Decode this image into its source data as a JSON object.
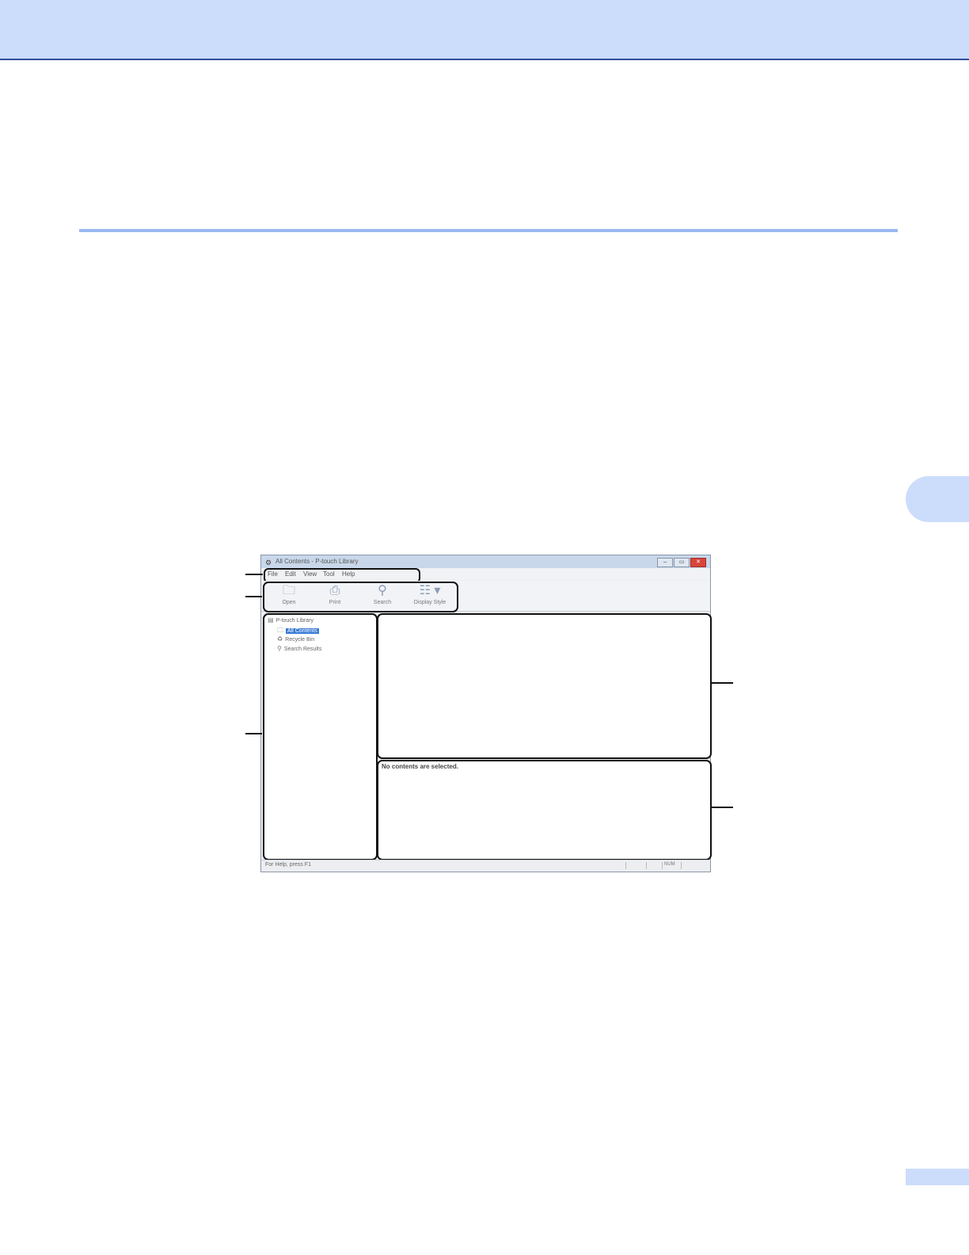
{
  "window": {
    "title": "All Contents - P-touch Library",
    "buttons": {
      "minimize": "–",
      "maximize": "▭",
      "close": "✕"
    }
  },
  "menu": [
    "File",
    "Edit",
    "View",
    "Tool",
    "Help"
  ],
  "toolbar": [
    {
      "label": "Open",
      "icon": "open-folder-icon"
    },
    {
      "label": "Print",
      "icon": "print-icon"
    },
    {
      "label": "Search",
      "icon": "search-icon"
    },
    {
      "label": "Display Style",
      "icon": "display-style-icon"
    }
  ],
  "tree": [
    {
      "label": "P-touch Library",
      "icon": "library-icon"
    },
    {
      "label": "All Contents",
      "icon": "folder-icon",
      "selected": true
    },
    {
      "label": "Recycle Bin",
      "icon": "recycle-bin-icon"
    },
    {
      "label": "Search Results",
      "icon": "search-icon"
    }
  ],
  "preview": {
    "text": "No contents are selected."
  },
  "status": {
    "help": "For Help, press F1",
    "mode": "NUM"
  },
  "colors": {
    "band": "#ccdcfb",
    "rule": "#9ab8f0",
    "band_border": "#2f4f9a"
  }
}
